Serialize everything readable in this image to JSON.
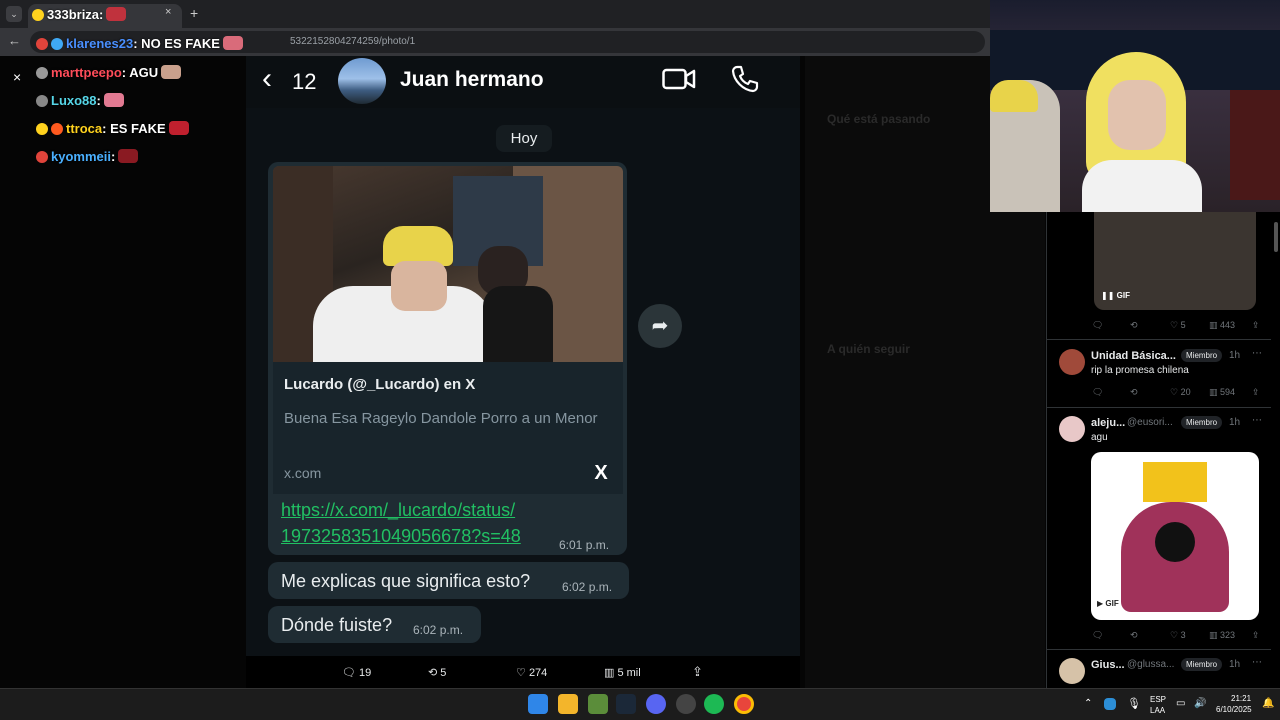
{
  "browser": {
    "tab_title": "333briza:",
    "tab_menu_icon": "chevron-down-icon",
    "new_tab": "+",
    "close_tab": "×",
    "url_fragment": "5322152804274259/photo/1",
    "back": "←"
  },
  "chat": {
    "close": "×",
    "lines": [
      {
        "user": "klarenes23",
        "text": ": NO ES FAKE",
        "user_color": "#4a90ff",
        "badge_color": "#e0443b"
      },
      {
        "user": "marttpeepo",
        "text": ": AGU",
        "user_color": "#ff4d5a",
        "badge_color": "#999999"
      },
      {
        "user": "Luxo88",
        "text": ":",
        "user_color": "#56d6e8",
        "badge_color": "#888888"
      },
      {
        "user": "ttroca",
        "text": ": ES FAKE",
        "user_color": "#ffd21e",
        "badge_color": "#ff9a00"
      },
      {
        "user": "kyommeii",
        "text": ":",
        "user_color": "#4ab0ff",
        "badge_color": "#e0443b"
      }
    ]
  },
  "whatsapp": {
    "back_icon": "chevron-left-icon",
    "unread_count": "12",
    "contact_name": "Juan hermano",
    "date_chip": "Hoy",
    "link_preview": {
      "title": "Lucardo (@_Lucardo) en X",
      "description": "Buena Esa Rageylo Dandole Porro a un Menor",
      "domain": "x.com",
      "logo": "X"
    },
    "link_line1": "https://x.com/_lucardo/status/",
    "link_line2": "1973258351049056678?s=48",
    "link_time": "6:01 p.m.",
    "messages": [
      {
        "text": "Me explicas que significa esto?",
        "time": "6:02 p.m."
      },
      {
        "text": "Dónde fuiste?",
        "time": "6:02 p.m."
      }
    ],
    "share_icon": "share-icon"
  },
  "tweet_actions": {
    "replies": "19",
    "reposts": "5",
    "likes": "274",
    "views": "5 mil"
  },
  "right_panel_faded": {
    "heading": "Qué está pasando",
    "who_to_follow": "A quién seguir"
  },
  "feed": {
    "first_post": {
      "gif_label": "GIF",
      "likes": "5",
      "views": "443"
    },
    "posts": [
      {
        "name": "Unidad Básica...",
        "badge": "Miembro",
        "time": "1h",
        "text": "rip la promesa chilena",
        "reposts": "",
        "likes": "20",
        "views": "594"
      },
      {
        "name": "aleju...",
        "handle": "@eusori...",
        "badge": "Miembro",
        "time": "1h",
        "text": "agu",
        "gif_label": "GIF",
        "likes": "3",
        "views": "323"
      },
      {
        "name": "Gius...",
        "handle": "@glussa...",
        "badge": "Miembro",
        "time": "1h"
      }
    ]
  },
  "taskbar": {
    "lang_top": "ESP",
    "lang_bottom": "LAA",
    "clock_time": "21:21",
    "clock_date": "6/10/2025"
  }
}
